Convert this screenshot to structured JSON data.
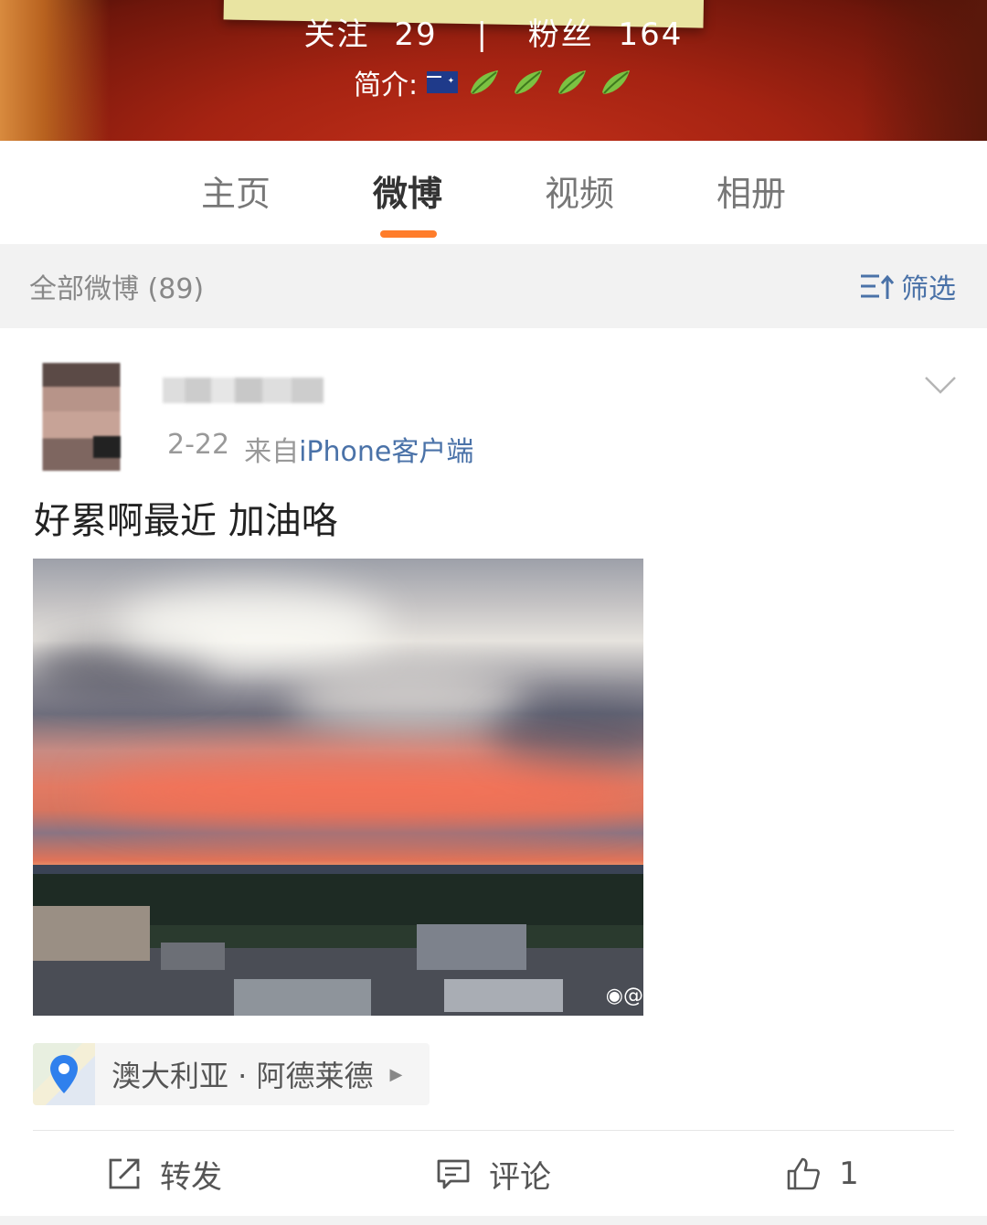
{
  "profile": {
    "follow_label": "关注",
    "follow_count": "29",
    "separator": "|",
    "fans_label": "粉丝",
    "fans_count": "164",
    "bio_label": "简介:"
  },
  "tabs": [
    {
      "label": "主页",
      "active": false
    },
    {
      "label": "微博",
      "active": true
    },
    {
      "label": "视频",
      "active": false
    },
    {
      "label": "相册",
      "active": false
    }
  ],
  "feed": {
    "count_label": "全部微博 (89)",
    "filter_label": "筛选"
  },
  "post": {
    "date": "2-22",
    "source_prefix": "来自",
    "source": "iPhone客户端",
    "text": "好累啊最近 加油咯",
    "image_watermark": "@",
    "location": "澳大利亚 · 阿德莱德",
    "actions": {
      "repost_label": "转发",
      "comment_label": "评论",
      "like_count": "1"
    }
  },
  "colors": {
    "accent_orange": "#ff7d2b",
    "link_blue": "#4a72a8"
  },
  "icons": [
    "australia-flag-icon",
    "leaf-icon",
    "filter-icon",
    "chevron-down-icon",
    "location-pin-icon",
    "repost-icon",
    "comment-icon",
    "like-icon",
    "weibo-logo-icon"
  ]
}
